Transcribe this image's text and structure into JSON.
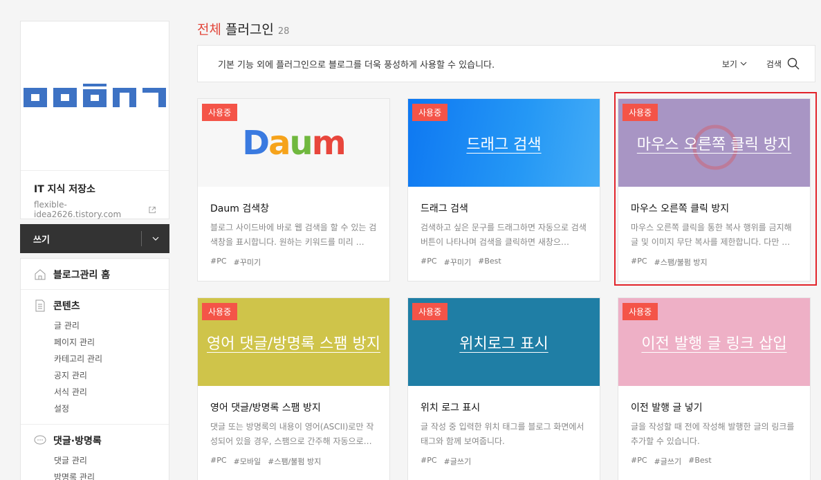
{
  "sidebar": {
    "blog_name": "IT 지식 저장소",
    "blog_url": "flexible-idea2626.tistory.com",
    "write_label": "쓰기",
    "menu": [
      {
        "label": "블로그관리 홈",
        "icon": "home-icon",
        "items": []
      },
      {
        "label": "콘텐츠",
        "icon": "document-icon",
        "items": [
          "글 관리",
          "페이지 관리",
          "카테고리 관리",
          "공지 관리",
          "서식 관리",
          "설정"
        ]
      },
      {
        "label": "댓글·방명록",
        "icon": "speech-bubble-icon",
        "items": [
          "댓글 관리",
          "방명록 관리"
        ]
      }
    ]
  },
  "header": {
    "title_accent": "전체",
    "title": "플러그인",
    "count": "28"
  },
  "info_bar": {
    "text": "기본 기능 외에 플러그인으로 블로그를 더욱 풍성하게 사용할 수 있습니다.",
    "view_label": "보기",
    "search_label": "검색"
  },
  "colors": {
    "accent": "#e2463a",
    "badge": "#f45448",
    "highlight": "#e2232a"
  },
  "cards": [
    {
      "badge": "사용중",
      "image_title": "",
      "title": "Daum 검색창",
      "desc": "블로그 사이드바에 바로 웹 검색을 할 수 있는 검색창을 표시합니다. 원하는 키워드를 미리 …",
      "tags": [
        "#PC",
        "#꾸미기"
      ],
      "bg": "#f7f7f7"
    },
    {
      "badge": "사용중",
      "image_title": "드래그 검색",
      "title": "드래그 검색",
      "desc": "검색하고 싶은 문구를 드래그하면 자동으로 검색 버튼이 나타나며 검색을 클릭하면 새창으…",
      "tags": [
        "#PC",
        "#꾸미기",
        "#Best"
      ],
      "bg": "#1a8ff0"
    },
    {
      "badge": "사용중",
      "image_title": "마우스 오른쪽 클릭 방지",
      "title": "마우스 오른쪽 클릭 방지",
      "desc": "마우스 오른쪽 클릭을 통한 복사 행위를 금지해 글 및 이미지 무단 복사를 제한합니다. 다만 …",
      "tags": [
        "#PC",
        "#스팸/불펌 방지"
      ],
      "bg": "#a895c4"
    },
    {
      "badge": "사용중",
      "image_title": "영어 댓글/방명록 스팸 방지",
      "title": "영어 댓글/방명록 스팸 방지",
      "desc": "댓글 또는 방명록의 내용이 영어(ASCII)로만 작성되어 있을 경우, 스팸으로 간주해 자동으로…",
      "tags": [
        "#PC",
        "#모바일",
        "#스팸/불펌 방지"
      ],
      "bg": "#cfc44a"
    },
    {
      "badge": "사용중",
      "image_title": "위치로그 표시",
      "title": "위치 로그 표시",
      "desc": "글 작성 중 입력한 위치 태그를 블로그 화면에서 태그와 함께 보여줍니다.",
      "tags": [
        "#PC",
        "#글쓰기"
      ],
      "bg": "#1f7ea5"
    },
    {
      "badge": "사용중",
      "image_title": "이전 발행 글 링크 삽입",
      "title": "이전 발행 글 넣기",
      "desc": "글을 작성할 때 전에 작성해 발행한 글의 링크를 추가할 수 있습니다.",
      "tags": [
        "#PC",
        "#글쓰기",
        "#Best"
      ],
      "bg": "#eeb0c6"
    }
  ]
}
